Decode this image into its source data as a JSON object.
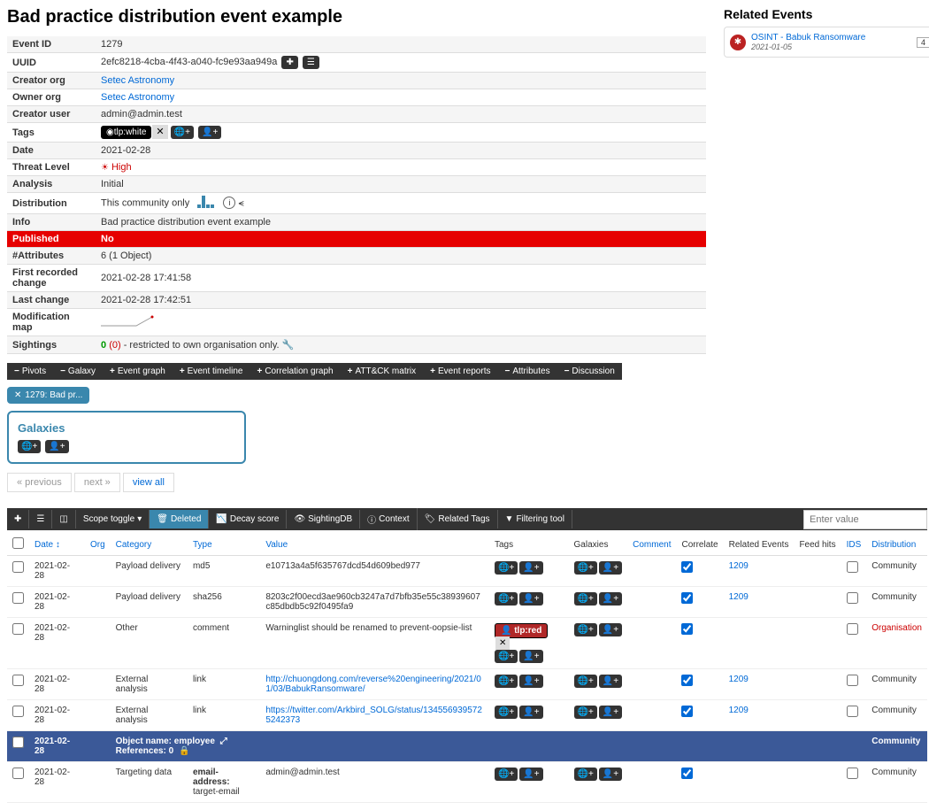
{
  "title": "Bad practice distribution event example",
  "meta": {
    "event_id_label": "Event ID",
    "event_id": "1279",
    "uuid_label": "UUID",
    "uuid": "2efc8218-4cba-4f43-a040-fc9e93aa949a",
    "creator_org_label": "Creator org",
    "creator_org": "Setec Astronomy",
    "owner_org_label": "Owner org",
    "owner_org": "Setec Astronomy",
    "creator_user_label": "Creator user",
    "creator_user": "admin@admin.test",
    "tags_label": "Tags",
    "tag_tlp": "tlp:white",
    "date_label": "Date",
    "date": "2021-02-28",
    "threat_label": "Threat Level",
    "threat": "High",
    "analysis_label": "Analysis",
    "analysis": "Initial",
    "distribution_label": "Distribution",
    "distribution": "This community only",
    "info_label": "Info",
    "info": "Bad practice distribution event example",
    "published_label": "Published",
    "published": "No",
    "attrs_label": "#Attributes",
    "attrs": "6 (1 Object)",
    "first_label": "First recorded change",
    "first": "2021-02-28 17:41:58",
    "last_label": "Last change",
    "last": "2021-02-28 17:42:51",
    "modmap_label": "Modification map",
    "sightings_label": "Sightings",
    "sightings_count": "0",
    "sightings_paren": "(0)",
    "sightings_rest": " - restricted to own organisation only."
  },
  "tabs": {
    "pivots": "Pivots",
    "galaxy": "Galaxy",
    "event_graph": "Event graph",
    "event_timeline": "Event timeline",
    "correlation": "Correlation graph",
    "attck": "ATT&CK matrix",
    "reports": "Event reports",
    "attributes": "Attributes",
    "discussion": "Discussion"
  },
  "chip": "1279: Bad pr...",
  "galaxies_title": "Galaxies",
  "pager": {
    "prev": "« previous",
    "next": "next »",
    "all": "view all"
  },
  "attr_toolbar": {
    "scope": "Scope toggle",
    "deleted": "Deleted",
    "decay": "Decay score",
    "sighting": "SightingDB",
    "context": "Context",
    "reltags": "Related Tags",
    "filter": "Filtering tool",
    "search_ph": "Enter value"
  },
  "cols": {
    "date": "Date",
    "org": "Org",
    "category": "Category",
    "type": "Type",
    "value": "Value",
    "tags": "Tags",
    "galaxies": "Galaxies",
    "comment": "Comment",
    "correlate": "Correlate",
    "related": "Related Events",
    "feed": "Feed hits",
    "ids": "IDS",
    "dist": "Distribution"
  },
  "rows": [
    {
      "date": "2021-02-28",
      "cat": "Payload delivery",
      "type": "md5",
      "value": "e10713a4a5f635767dcd54d609bed977",
      "correlate": true,
      "related": "1209",
      "ids": false,
      "dist": "Community"
    },
    {
      "date": "2021-02-28",
      "cat": "Payload delivery",
      "type": "sha256",
      "value": "8203c2f00ecd3ae960cb3247a7d7bfb35e55c38939607c85dbdb5c92f0495fa9",
      "correlate": true,
      "related": "1209",
      "ids": false,
      "dist": "Community"
    },
    {
      "date": "2021-02-28",
      "cat": "Other",
      "type": "comment",
      "value": "Warninglist should be renamed to prevent-oopsie-list",
      "tag": "tlp:red",
      "correlate": true,
      "related": "",
      "ids": false,
      "dist": "Organisation",
      "dist_red": true
    },
    {
      "date": "2021-02-28",
      "cat": "External analysis",
      "type": "link",
      "value": "http://chuongdong.com/reverse%20engineering/2021/01/03/BabukRansomware/",
      "is_link": true,
      "correlate": true,
      "related": "1209",
      "ids": false,
      "dist": "Community"
    },
    {
      "date": "2021-02-28",
      "cat": "External analysis",
      "type": "link",
      "value": "https://twitter.com/Arkbird_SOLG/status/1345569395725242373",
      "is_link": true,
      "correlate": true,
      "related": "1209",
      "ids": false,
      "dist": "Community"
    }
  ],
  "obj": {
    "date": "2021-02-28",
    "name_label": "Object name:",
    "name": "employee",
    "refs_label": "References:",
    "refs": "0",
    "dist": "Community"
  },
  "obj_row": {
    "date": "2021-02-28",
    "cat": "Targeting data",
    "type1": "email-address:",
    "type2": "target-email",
    "value": "admin@admin.test",
    "correlate": true,
    "ids": false,
    "dist": "Community"
  },
  "related": {
    "title": "Related Events",
    "item_title": "OSINT - Babuk Ransomware",
    "item_date": "2021-01-05",
    "item_count": "4"
  }
}
